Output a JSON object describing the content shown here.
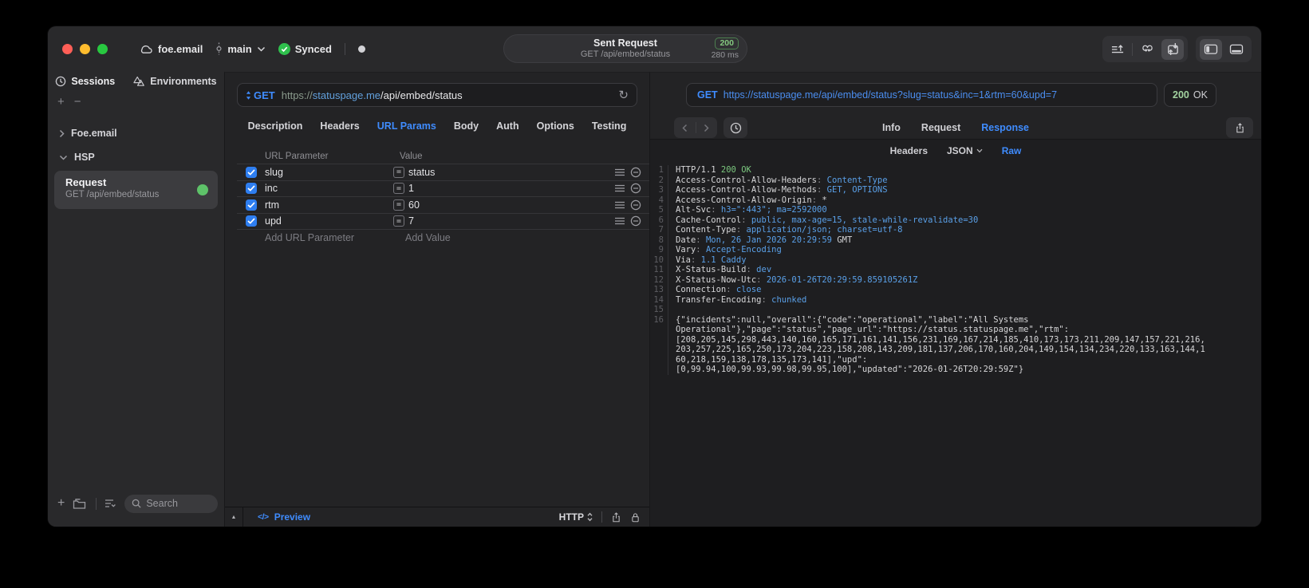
{
  "titlebar": {
    "project": "foe.email",
    "branch": "main",
    "sync_label": "Synced",
    "request_pill": {
      "title": "Sent Request",
      "subtitle": "GET /api/embed/status",
      "status_code": "200",
      "duration": "280 ms"
    }
  },
  "sidebar": {
    "tabs": [
      {
        "label": "Sessions",
        "icon": "clock-icon"
      },
      {
        "label": "Environments",
        "icon": "environments-icon"
      }
    ],
    "groups": [
      {
        "label": "Foe.email",
        "expanded": false
      },
      {
        "label": "HSP",
        "expanded": true
      }
    ],
    "request_item": {
      "title": "Request",
      "subtitle": "GET /api/embed/status"
    },
    "search_placeholder": "Search"
  },
  "editor": {
    "method": "GET",
    "url_scheme": "https://",
    "url_host": "statuspage.me",
    "url_path": "/api/embed/status",
    "tabs": [
      "Description",
      "Headers",
      "URL Params",
      "Body",
      "Auth",
      "Options",
      "Testing"
    ],
    "active_tab": "URL Params",
    "params": {
      "columns": [
        "URL Parameter",
        "Value"
      ],
      "rows": [
        {
          "name": "slug",
          "value": "status",
          "enabled": true
        },
        {
          "name": "inc",
          "value": "1",
          "enabled": true
        },
        {
          "name": "rtm",
          "value": "60",
          "enabled": true
        },
        {
          "name": "upd",
          "value": "7",
          "enabled": true
        }
      ],
      "add_name_placeholder": "Add URL Parameter",
      "add_value_placeholder": "Add Value"
    },
    "footer": {
      "preview_label": "Preview",
      "protocol": "HTTP"
    }
  },
  "response": {
    "method": "GET",
    "url": "https://statuspage.me/api/embed/status?slug=status&inc=1&rtm=60&upd=7",
    "status_code": "200",
    "status_text": "OK",
    "tabs": [
      "Info",
      "Request",
      "Response"
    ],
    "active_tab": "Response",
    "view_tabs": [
      "Headers",
      "JSON",
      "Raw"
    ],
    "active_view": "Raw",
    "body_lines": [
      {
        "num": 1,
        "segments": [
          {
            "text": "HTTP/1.1 ",
            "color": "plain"
          },
          {
            "text": "200 OK",
            "color": "green"
          }
        ]
      },
      {
        "num": 2,
        "segments": [
          {
            "text": "Access-Control-Allow-Headers",
            "color": "plain"
          },
          {
            "text": ": ",
            "color": "gray"
          },
          {
            "text": "Content-Type",
            "color": "blue"
          }
        ]
      },
      {
        "num": 3,
        "segments": [
          {
            "text": "Access-Control-Allow-Methods",
            "color": "plain"
          },
          {
            "text": ": ",
            "color": "gray"
          },
          {
            "text": "GET, OPTIONS",
            "color": "blue"
          }
        ]
      },
      {
        "num": 4,
        "segments": [
          {
            "text": "Access-Control-Allow-Origin",
            "color": "plain"
          },
          {
            "text": ": ",
            "color": "gray"
          },
          {
            "text": "*",
            "color": "plain"
          }
        ]
      },
      {
        "num": 5,
        "segments": [
          {
            "text": "Alt-Svc",
            "color": "plain"
          },
          {
            "text": ": ",
            "color": "gray"
          },
          {
            "text": "h3=\":443\"; ma=2592000",
            "color": "blue"
          }
        ]
      },
      {
        "num": 6,
        "segments": [
          {
            "text": "Cache-Control",
            "color": "plain"
          },
          {
            "text": ": ",
            "color": "gray"
          },
          {
            "text": "public, max-age=15, stale-while-revalidate=30",
            "color": "blue"
          }
        ]
      },
      {
        "num": 7,
        "segments": [
          {
            "text": "Content-Type",
            "color": "plain"
          },
          {
            "text": ": ",
            "color": "gray"
          },
          {
            "text": "application/json; charset=utf-8",
            "color": "blue"
          }
        ]
      },
      {
        "num": 8,
        "segments": [
          {
            "text": "Date",
            "color": "plain"
          },
          {
            "text": ": ",
            "color": "gray"
          },
          {
            "text": "Mon, 26 Jan 2026 20:29:59",
            "color": "blue"
          },
          {
            "text": " GMT",
            "color": "plain"
          }
        ]
      },
      {
        "num": 9,
        "segments": [
          {
            "text": "Vary",
            "color": "plain"
          },
          {
            "text": ": ",
            "color": "gray"
          },
          {
            "text": "Accept-Encoding",
            "color": "blue"
          }
        ]
      },
      {
        "num": 10,
        "segments": [
          {
            "text": "Via",
            "color": "plain"
          },
          {
            "text": ": ",
            "color": "gray"
          },
          {
            "text": "1.1 Caddy",
            "color": "blue"
          }
        ]
      },
      {
        "num": 11,
        "segments": [
          {
            "text": "X-Status-Build",
            "color": "plain"
          },
          {
            "text": ": ",
            "color": "gray"
          },
          {
            "text": "dev",
            "color": "blue"
          }
        ]
      },
      {
        "num": 12,
        "segments": [
          {
            "text": "X-Status-Now-Utc",
            "color": "plain"
          },
          {
            "text": ": ",
            "color": "gray"
          },
          {
            "text": "2026-01-26T20:29:59.859105261Z",
            "color": "blue"
          }
        ]
      },
      {
        "num": 13,
        "segments": [
          {
            "text": "Connection",
            "color": "plain"
          },
          {
            "text": ": ",
            "color": "gray"
          },
          {
            "text": "close",
            "color": "blue"
          }
        ]
      },
      {
        "num": 14,
        "segments": [
          {
            "text": "Transfer-Encoding",
            "color": "plain"
          },
          {
            "text": ": ",
            "color": "gray"
          },
          {
            "text": "chunked",
            "color": "blue"
          }
        ]
      },
      {
        "num": 15,
        "segments": []
      },
      {
        "num": 16,
        "segments": [
          {
            "text": "{\"incidents\":null,\"overall\":{\"code\":\"operational\",\"label\":\"All Systems\nOperational\"},\"page\":\"status\",\"page_url\":\"https://status.statuspage.me\",\"rtm\":\n[208,205,145,298,443,140,160,165,171,161,141,156,231,169,167,214,185,410,173,173,211,209,147,157,221,216,\n203,257,225,165,250,173,204,223,158,208,143,209,181,137,206,170,160,204,149,154,134,234,220,133,163,144,1\n60,218,159,138,178,135,173,141],\"upd\":\n[0,99.94,100,99.93,99.98,99.95,100],\"updated\":\"2026-01-26T20:29:59Z\"}",
            "color": "plain"
          }
        ]
      }
    ]
  },
  "colors": {
    "accent_blue": "#3f8cff",
    "code_value_blue": "#5aa0e8",
    "success_green": "#7cc87f",
    "status_badge_green": "#84c97f",
    "checkbox_blue": "#2e7ef0",
    "request_dot_green": "#5ec269",
    "traffic_red": "#ff5f57",
    "traffic_yellow": "#febc2e",
    "traffic_green": "#28c840"
  }
}
